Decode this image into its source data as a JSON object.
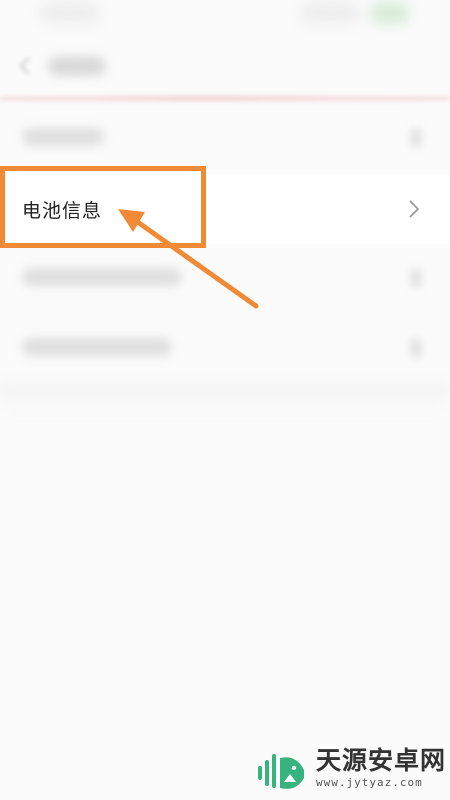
{
  "list": {
    "highlighted_item": {
      "label": "电池信息",
      "icon": "chevron-right-icon"
    }
  },
  "header": {
    "back_icon": "back-arrow-icon"
  },
  "annotation": {
    "highlight_color": "#f08a36",
    "arrow_color": "#f08a36"
  },
  "watermark": {
    "name": "天源安卓网",
    "url": "www.jytyaz.com",
    "logo_icon": "android-logo-icon",
    "logo_color": "#36b37e"
  },
  "colors": {
    "background": "#fbfbfb",
    "row_background": "#ffffff",
    "text": "#222222"
  }
}
